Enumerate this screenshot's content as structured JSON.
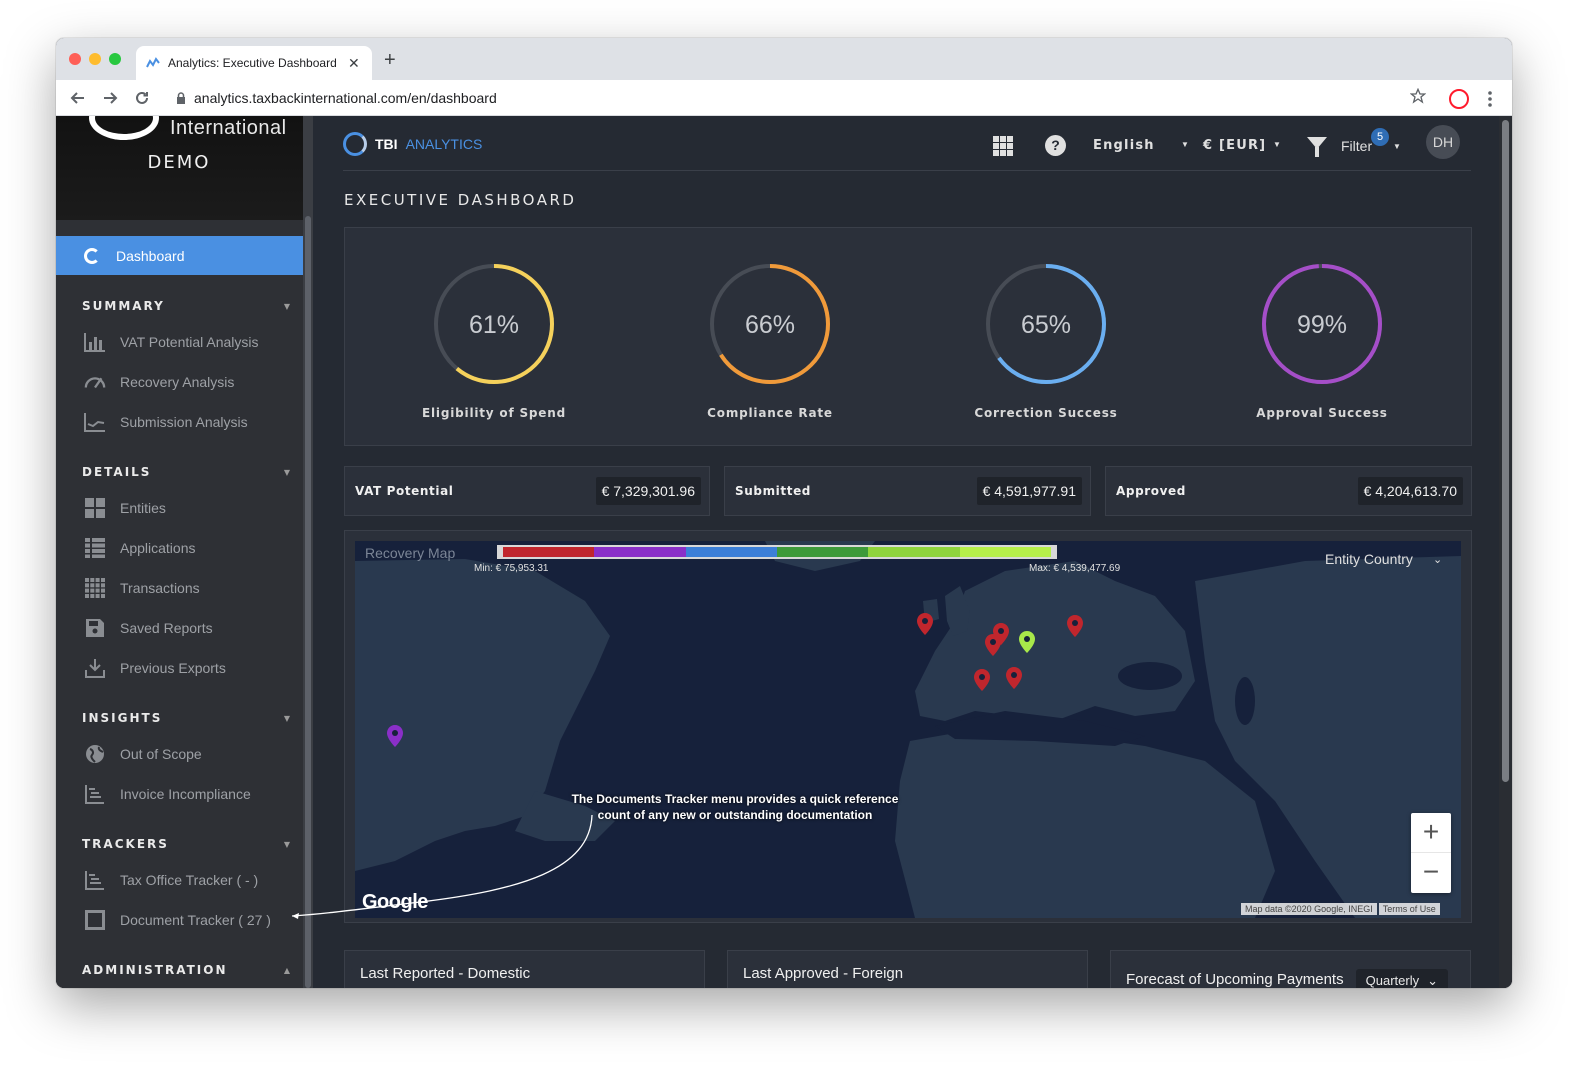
{
  "browser": {
    "tab_title": "Analytics: Executive Dashboard",
    "close_glyph": "✕",
    "newtab_glyph": "+",
    "url": "analytics.taxbackinternational.com/en/dashboard"
  },
  "sidebar": {
    "logo_text": "International",
    "demo_label": "DEMO",
    "active_item": "Dashboard",
    "sections": {
      "summary": "SUMMARY",
      "details": "DETAILS",
      "insights": "INSIGHTS",
      "trackers": "TRACKERS",
      "administration": "ADMINISTRATION"
    },
    "summary_items": [
      "VAT Potential Analysis",
      "Recovery Analysis",
      "Submission Analysis"
    ],
    "details_items": [
      "Entities",
      "Applications",
      "Transactions",
      "Saved Reports",
      "Previous Exports"
    ],
    "insights_items": [
      "Out of Scope",
      "Invoice Incompliance"
    ],
    "tracker_items": [
      "Tax Office Tracker ( - )",
      "Document Tracker ( 27 )"
    ]
  },
  "header": {
    "brand_tbi": "TBI",
    "brand_analytics": "ANALYTICS",
    "help_glyph": "?",
    "language": "English",
    "currency": "€ [EUR]",
    "filter_label": "Filter",
    "filter_count": "5",
    "avatar_initials": "DH"
  },
  "page_title": "EXECUTIVE DASHBOARD",
  "kpis": [
    {
      "label": "Eligibility of Spend",
      "value": "61%",
      "fraction": 0.61,
      "color": "#f5d15b"
    },
    {
      "label": "Compliance Rate",
      "value": "66%",
      "fraction": 0.66,
      "color": "#f09a3a"
    },
    {
      "label": "Correction Success",
      "value": "65%",
      "fraction": 0.65,
      "color": "#6aaef0"
    },
    {
      "label": "Approval Success",
      "value": "99%",
      "fraction": 0.99,
      "color": "#a54ec8"
    }
  ],
  "stats": [
    {
      "label": "VAT Potential",
      "value": "€ 7,329,301.96"
    },
    {
      "label": "Submitted",
      "value": "€ 4,591,977.91"
    },
    {
      "label": "Approved",
      "value": "€ 4,204,613.70"
    }
  ],
  "map": {
    "title": "Recovery Map",
    "legend_min": "Min: € 75,953.31",
    "legend_max": "Max: € 4,539,477.69",
    "legend_colors": [
      "#c0262d",
      "#8a2fc8",
      "#3c7fd8",
      "#3e9a3a",
      "#8fd43c",
      "#b6ef4a"
    ],
    "grouping": "Entity Country",
    "zoom_in": "+",
    "zoom_out": "−",
    "provider": "Google",
    "attribution": "Map data ©2020 Google, INEGI",
    "terms": "Terms of Use",
    "callout": "The Documents Tracker menu provides a quick reference count of any new or outstanding documentation",
    "marker_colors": {
      "red": "#c0262d",
      "green": "#a8e84a",
      "purple": "#8a2fc8"
    }
  },
  "bottom_cards": {
    "domestic": "Last Reported - Domestic",
    "foreign": "Last Approved - Foreign",
    "forecast": "Forecast of Upcoming Payments",
    "forecast_period": "Quarterly"
  }
}
